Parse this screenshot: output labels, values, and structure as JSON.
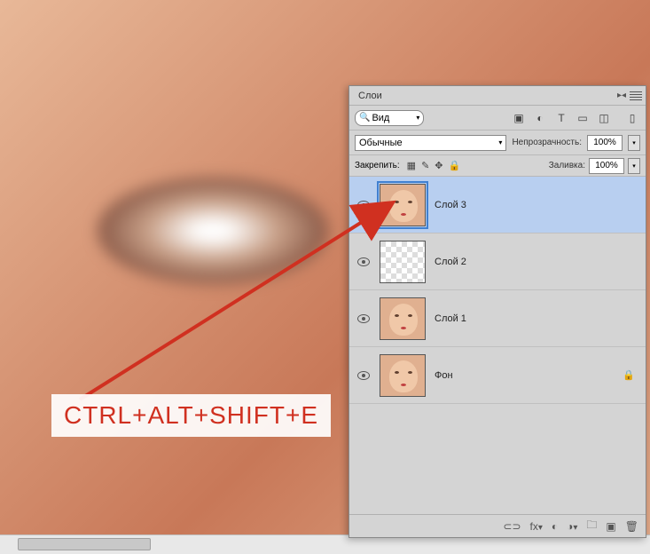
{
  "panel": {
    "title": "Слои",
    "filter_kind": "Вид",
    "blend_mode": "Обычные",
    "opacity_label": "Непрозрачность:",
    "opacity_value": "100%",
    "lock_label": "Закрепить:",
    "fill_label": "Заливка:",
    "fill_value": "100%"
  },
  "layers": [
    {
      "name": "Слой 3",
      "selected": true,
      "visible": true,
      "thumb": "face",
      "locked": false
    },
    {
      "name": "Слой 2",
      "selected": false,
      "visible": true,
      "thumb": "transparent",
      "locked": false
    },
    {
      "name": "Слой 1",
      "selected": false,
      "visible": true,
      "thumb": "face",
      "locked": false
    },
    {
      "name": "Фон",
      "selected": false,
      "visible": true,
      "thumb": "face",
      "locked": true
    }
  ],
  "annotation": {
    "text": "CTRL+ALT+SHIFT+E"
  },
  "colors": {
    "accent": "#d03020",
    "panel": "#d4d4d4",
    "selected": "#b8cff0"
  }
}
